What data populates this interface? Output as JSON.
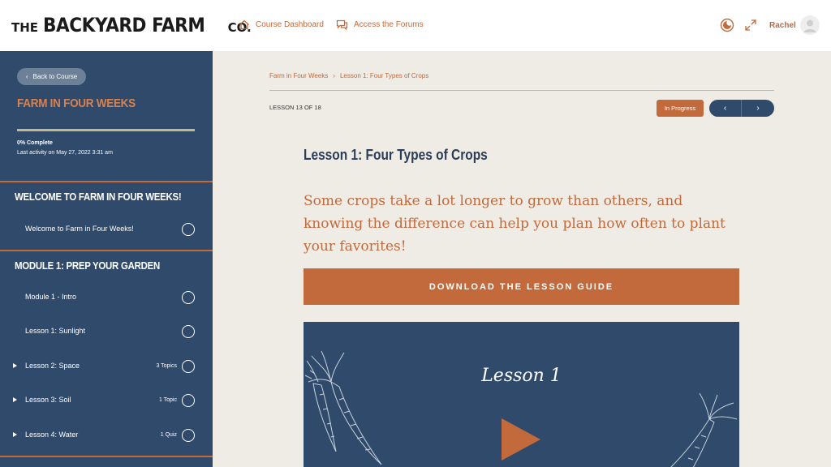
{
  "brand": {
    "prefix": "THE",
    "name": "BACKYARD FARM",
    "suffix": "CO."
  },
  "header": {
    "nav": [
      {
        "label": "Course Dashboard",
        "icon": "home-icon"
      },
      {
        "label": "Access the Forums",
        "icon": "chat-icon"
      }
    ],
    "username": "Rachel",
    "icons": [
      "dark-mode-icon",
      "expand-icon",
      "avatar-icon"
    ]
  },
  "sidebar": {
    "back_label": "Back to Course",
    "course_title": "FARM IN FOUR WEEKS",
    "progress": 0,
    "percent_label": "0% Complete",
    "last_activity": "Last activity on May 27, 2022 3:31 am",
    "sections": [
      {
        "title": "WELCOME TO FARM IN FOUR WEEKS!",
        "items": [
          {
            "label": "Welcome to Farm in Four Weeks!",
            "meta": "",
            "expandable": false
          }
        ]
      },
      {
        "title": "MODULE 1: PREP YOUR GARDEN",
        "items": [
          {
            "label": "Module 1 - Intro",
            "meta": "",
            "expandable": false
          },
          {
            "label": "Lesson 1: Sunlight",
            "meta": "",
            "expandable": false
          },
          {
            "label": "Lesson 2: Space",
            "meta": "3 Topics",
            "expandable": true
          },
          {
            "label": "Lesson 3: Soil",
            "meta": "1 Topic",
            "expandable": true
          },
          {
            "label": "Lesson 4: Water",
            "meta": "1 Quiz",
            "expandable": true
          }
        ]
      }
    ]
  },
  "main": {
    "breadcrumb": [
      "Farm in Four Weeks",
      "Lesson 1: Four Types of Crops"
    ],
    "breadcrumb_sep": "›",
    "lesson_count": "LESSON 13 OF 18",
    "status": "In Progress",
    "prev_label": "‹",
    "next_label": "›",
    "lesson_title": "Lesson 1: Four Types of Crops",
    "intro": "Some crops take a lot longer to grow than others, and knowing the difference can help you plan how often to plant your favorites!",
    "download_label": "DOWNLOAD THE LESSON GUIDE",
    "video_title": "Lesson 1"
  },
  "colors": {
    "navy": "#2f4a6b",
    "accent": "#c26a3c",
    "background": "#efebe5"
  }
}
